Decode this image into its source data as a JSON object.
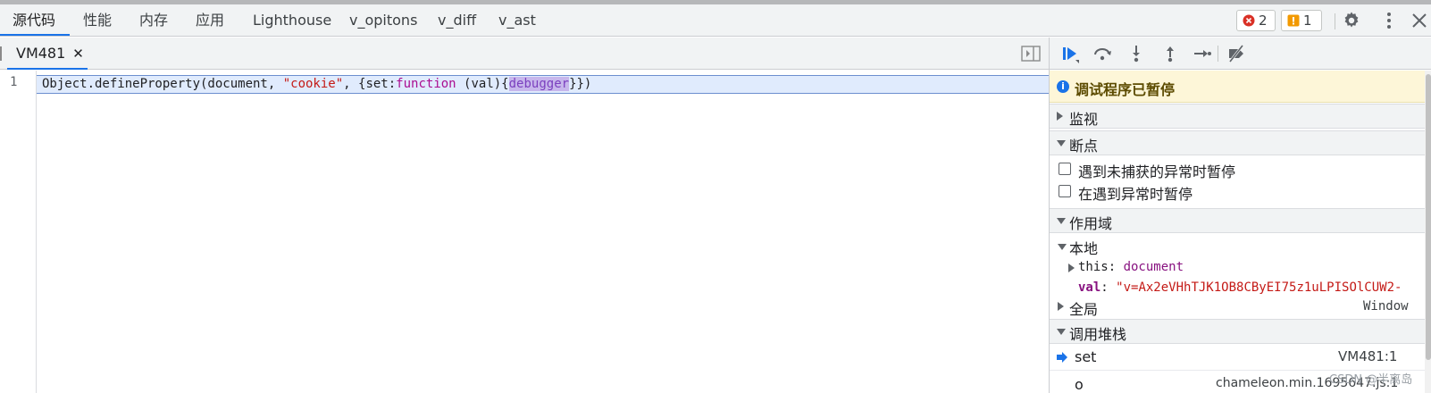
{
  "devtools_tabs": [
    {
      "label": "源代码",
      "active": true
    },
    {
      "label": "性能"
    },
    {
      "label": "内存"
    },
    {
      "label": "应用"
    },
    {
      "label": "Lighthouse"
    },
    {
      "label": "v_opitons"
    },
    {
      "label": "v_diff"
    },
    {
      "label": "v_ast"
    }
  ],
  "toolbar": {
    "error_count": "2",
    "warning_count": "1",
    "settings_icon": "gear-icon",
    "more_icon": "kebab-menu-icon",
    "close_icon": "close-icon"
  },
  "editor": {
    "file_tab": "VM481",
    "close_glyph": "✕",
    "line_number": "1",
    "code_tokens": {
      "t1": "Object.defineProperty(document, ",
      "t2": "\"cookie\"",
      "t3": ", {set:",
      "t4": "function",
      "t5": " (val){",
      "t6": "debugger",
      "t7": "}})"
    }
  },
  "debugger": {
    "paused_message": "调试程序已暂停",
    "sections": {
      "watch": "监视",
      "breakpoints": "断点",
      "scope": "作用域",
      "callstack": "调用堆栈"
    },
    "breakpoint_options": [
      {
        "label": "遇到未捕获的异常时暂停",
        "checked": false
      },
      {
        "label": "在遇到异常时暂停",
        "checked": false
      }
    ],
    "scope": {
      "local_label": "本地",
      "this_name": "this",
      "this_value": "document",
      "val_name": "val",
      "val_value": "\"v=Ax2eVHhTJK1OB8CByEI75z1uLPISOlCUW2-",
      "global_label": "全局",
      "global_value": "Window"
    },
    "call_stack": [
      {
        "name": "set",
        "location": "VM481:1"
      },
      {
        "name": "o",
        "location": "chameleon.min.1695647.js:1"
      }
    ]
  },
  "watermark": "CSDN @半离岛",
  "colors": {
    "accent": "#1a73e8",
    "error": "#d93025",
    "warning": "#f29900",
    "paused_bg": "#fdf6d8"
  }
}
